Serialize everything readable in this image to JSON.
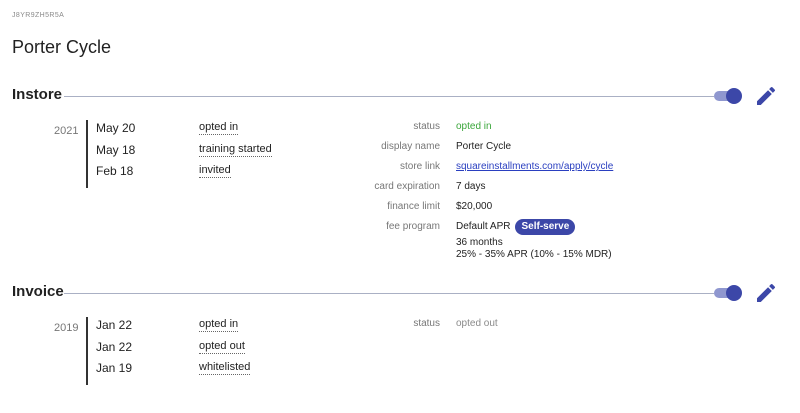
{
  "merchant": {
    "id": "J8YR9ZH5R5A",
    "name": "Porter Cycle"
  },
  "instore": {
    "title": "Instore",
    "enabled": true,
    "year": "2021",
    "events": [
      {
        "date": "May 20",
        "label": "opted in"
      },
      {
        "date": "May 18",
        "label": "training started"
      },
      {
        "date": "Feb 18",
        "label": "invited"
      }
    ],
    "details": {
      "status_key": "status",
      "status_val": "opted in",
      "display_key": "display name",
      "display_val": "Porter Cycle",
      "link_key": "store link",
      "link_val": "squareinstallments.com/apply/cycle",
      "card_key": "card expiration",
      "card_val": "7 days",
      "limit_key": "finance limit",
      "limit_val": "$20,000",
      "fee_key": "fee program",
      "fee_name": "Default APR",
      "fee_badge": "Self-serve",
      "fee_term": "36 months",
      "fee_rates": "25% - 35% APR (10% - 15% MDR)"
    }
  },
  "invoice": {
    "title": "Invoice",
    "enabled": true,
    "year": "2019",
    "events": [
      {
        "date": "Jan 22",
        "label": "opted in"
      },
      {
        "date": "Jan 22",
        "label": "opted out"
      },
      {
        "date": "Jan 19",
        "label": "whitelisted"
      }
    ],
    "details": {
      "status_key": "status",
      "status_val": "opted out"
    }
  },
  "colors": {
    "accent": "#3c47a8",
    "toggle_track": "#8f97cf",
    "status_green": "#3aa63a",
    "link": "#2a3fc0"
  },
  "icons": {
    "edit": "pencil-icon"
  }
}
